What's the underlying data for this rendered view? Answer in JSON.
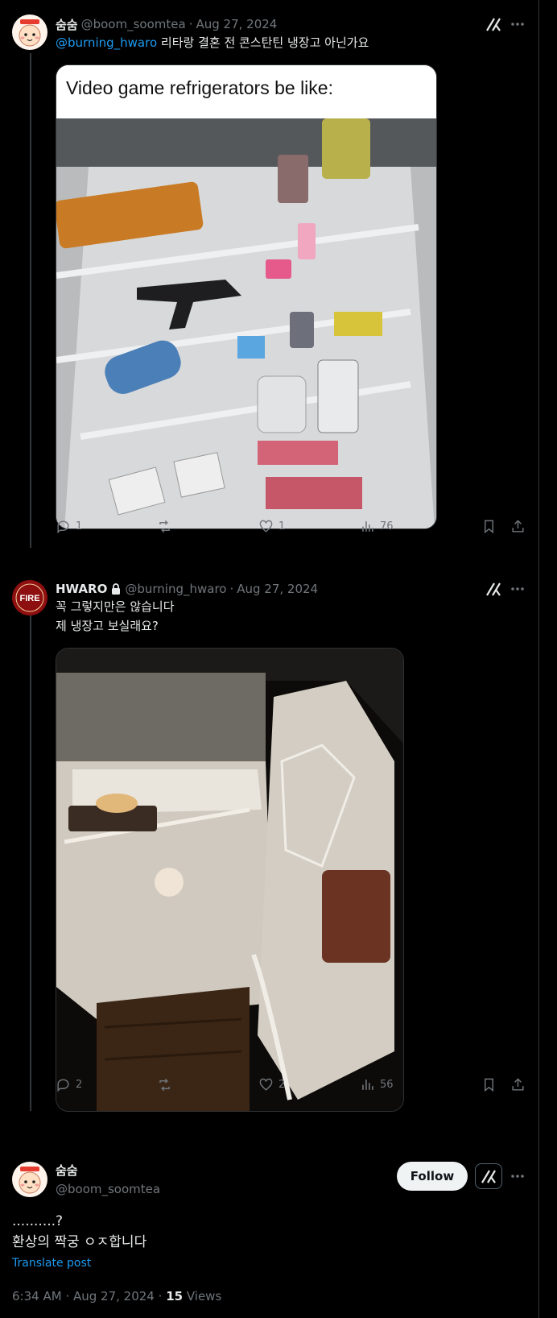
{
  "tweet1": {
    "display_name": "숨숨",
    "handle": "@boom_soomtea",
    "separator": "·",
    "date": "Aug 27, 2024",
    "mention": "@burning_hwaro",
    "text": "리타랑 결혼 전 콘스탄틴 냉장고 아닌가요",
    "media_caption": "Video game refrigerators be like:",
    "media_icon": "fridge-with-items-photo",
    "replies": "1",
    "reposts": "",
    "likes": "1",
    "views": "76"
  },
  "tweet2": {
    "display_name": "HWARO",
    "handle": "@burning_hwaro",
    "separator": "·",
    "date": "Aug 27, 2024",
    "text_line1": "꼭 그렇지만은 않습니다",
    "text_line2": "제 냉장고 보실래요?",
    "media_icon": "open-dark-fridge-photo",
    "replies": "2",
    "reposts": "",
    "likes": "2",
    "views": "56"
  },
  "tweet3": {
    "display_name": "숨숨",
    "handle": "@boom_soomtea",
    "follow_label": "Follow",
    "text_line1": "..........?",
    "text_line2": "환상의 짝궁 ㅇㅈ합니다",
    "translate_label": "Translate post",
    "time": "6:34 AM",
    "separator": "·",
    "date": "Aug 27, 2024",
    "views_count": "15",
    "views_label": "Views"
  },
  "colors": {
    "background": "#000000",
    "text": "#e7e9ea",
    "muted": "#71767b",
    "accent": "#1d9bf0",
    "border": "#2f3336"
  }
}
